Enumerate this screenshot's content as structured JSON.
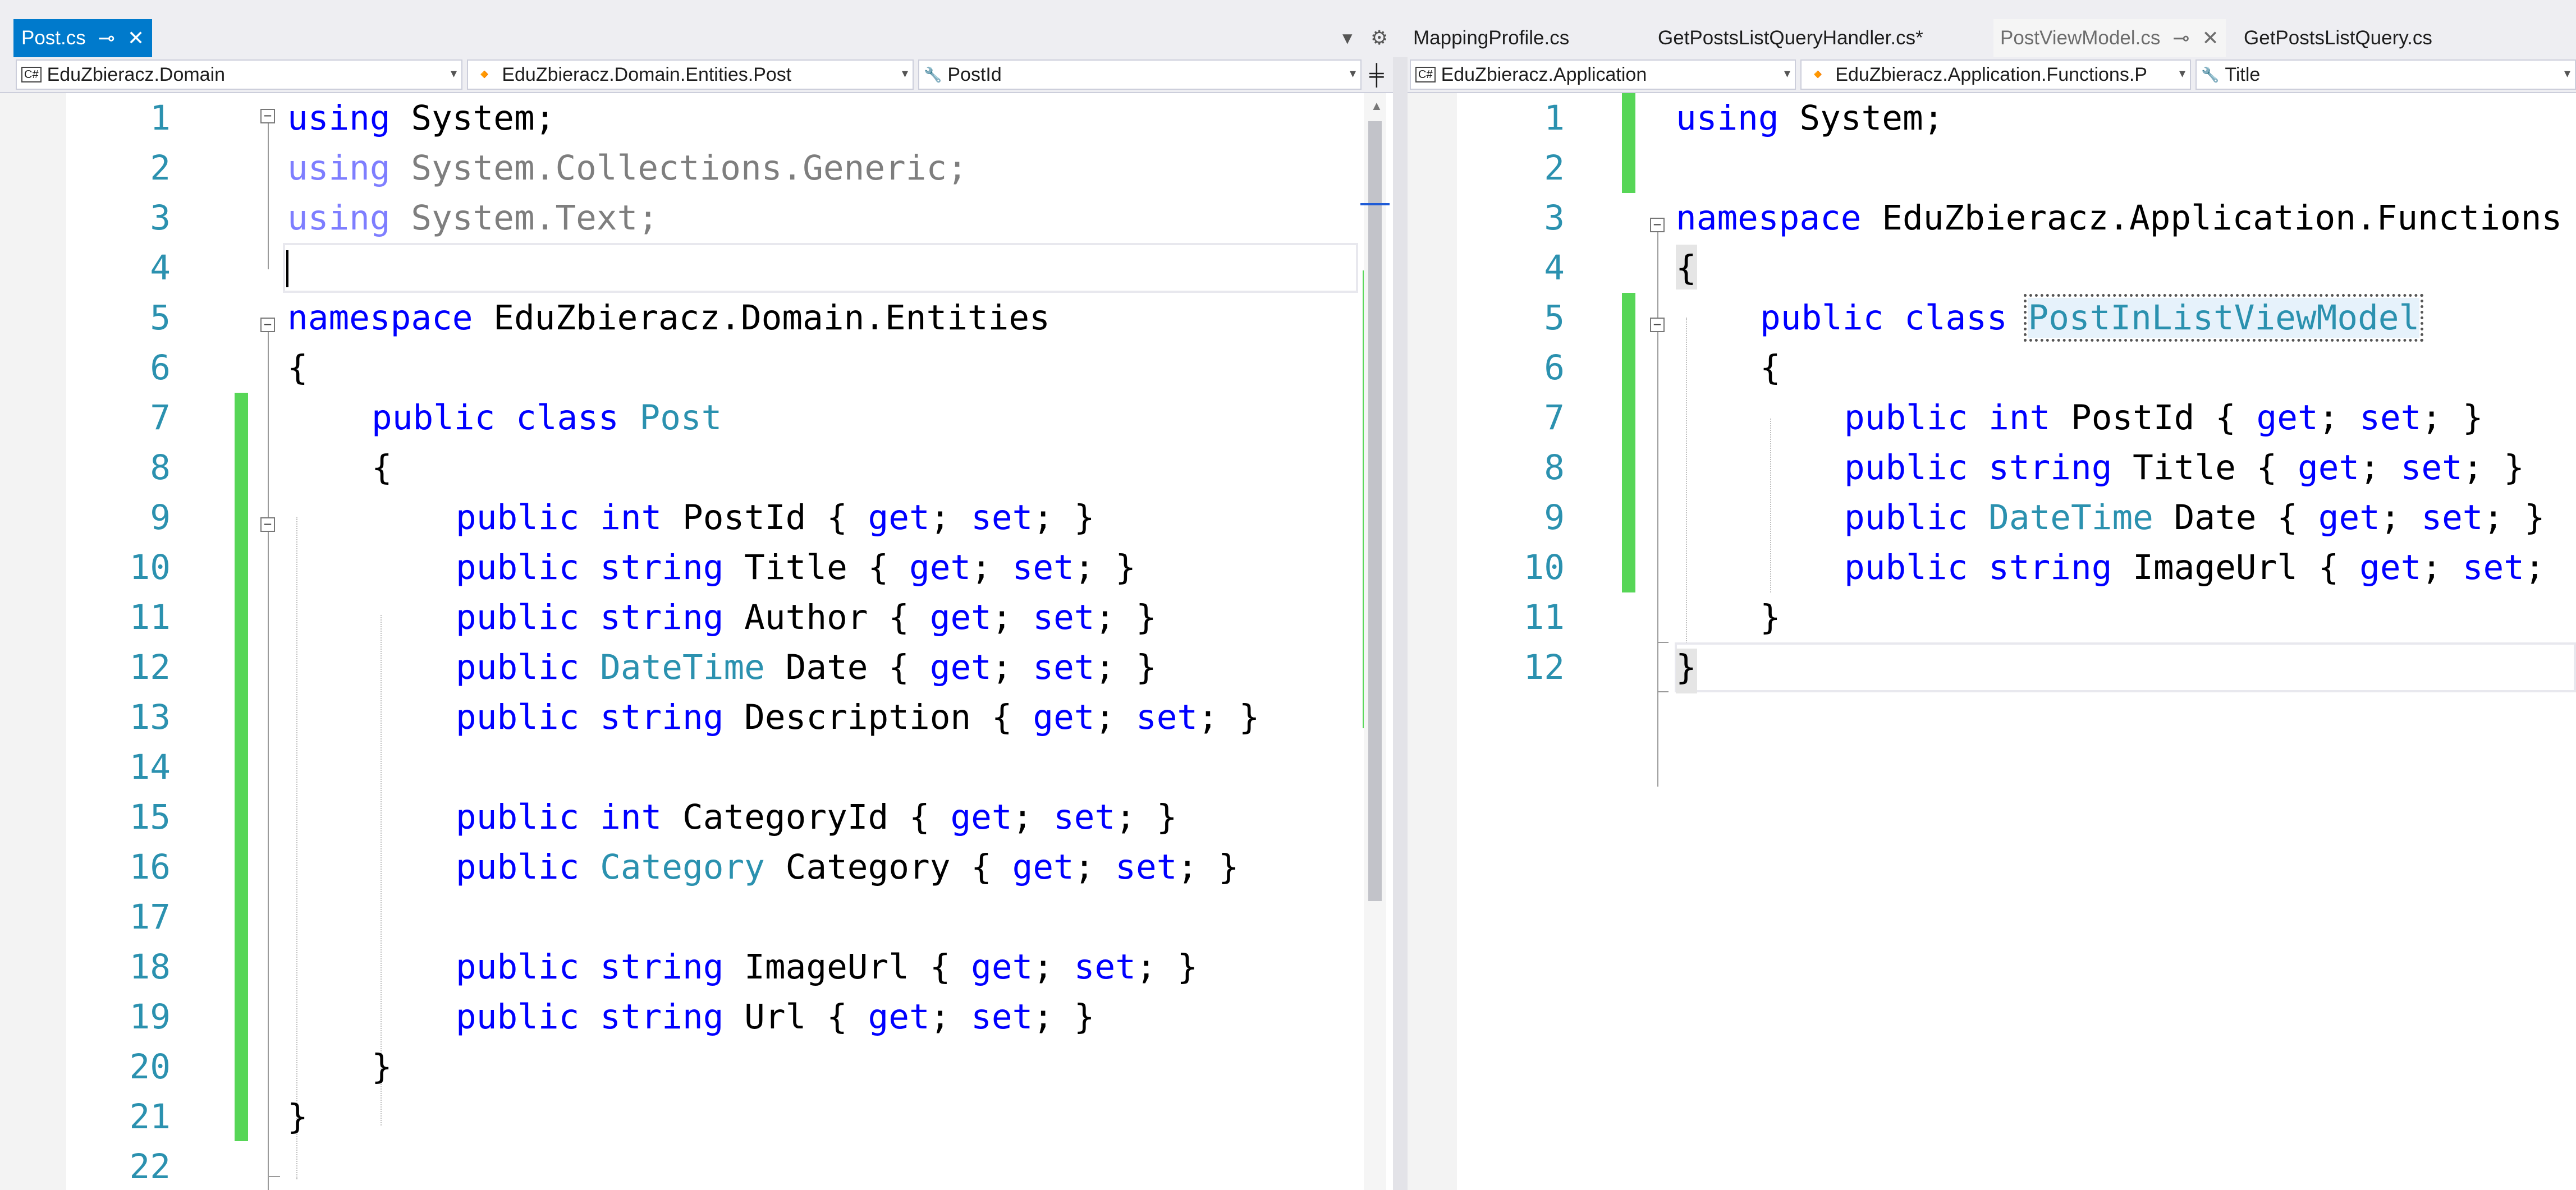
{
  "left_pane": {
    "tabs": [
      {
        "label": "Post.cs",
        "active": true
      }
    ],
    "nav": {
      "project": "EduZbieracz.Domain",
      "type": "EduZbieracz.Domain.Entities.Post",
      "member": "PostId"
    },
    "lines": [
      "1",
      "2",
      "3",
      "4",
      "5",
      "6",
      "7",
      "8",
      "9",
      "10",
      "11",
      "12",
      "13",
      "14",
      "15",
      "16",
      "17",
      "18",
      "19",
      "20",
      "21",
      "22"
    ],
    "code": {
      "l1": [
        "using",
        " System;"
      ],
      "l2": [
        "using",
        " System.Collections.Generic;"
      ],
      "l3": [
        "using",
        " System.Text;"
      ],
      "l5": [
        "namespace",
        " EduZbieracz.Domain.Entities"
      ],
      "l6": "{",
      "l7": [
        "public",
        "class",
        "Post"
      ],
      "l8": "{",
      "l9": [
        "public",
        "int",
        " PostId { ",
        "get",
        "; ",
        "set",
        "; }"
      ],
      "l10": [
        "public",
        "string",
        " Title { ",
        "get",
        "; ",
        "set",
        "; }"
      ],
      "l11": [
        "public",
        "string",
        " Author { ",
        "get",
        "; ",
        "set",
        "; }"
      ],
      "l12": [
        "public",
        "DateTime",
        " Date { ",
        "get",
        "; ",
        "set",
        "; }"
      ],
      "l13": [
        "public",
        "string",
        " Description { ",
        "get",
        "; ",
        "set",
        "; }"
      ],
      "l15": [
        "public",
        "int",
        " CategoryId { ",
        "get",
        "; ",
        "set",
        "; }"
      ],
      "l16": [
        "public",
        "Category",
        " Category { ",
        "get",
        "; ",
        "set",
        "; }"
      ],
      "l18": [
        "public",
        "string",
        " ImageUrl { ",
        "get",
        "; ",
        "set",
        "; }"
      ],
      "l19": [
        "public",
        "string",
        " Url { ",
        "get",
        "; ",
        "set",
        "; }"
      ],
      "l20": "}",
      "l21": "}"
    }
  },
  "right_pane": {
    "tabs": [
      {
        "label": "MappingProfile.cs"
      },
      {
        "label": "GetPostsListQueryHandler.cs*"
      },
      {
        "label": "PostViewModel.cs",
        "preview": true
      },
      {
        "label": "GetPostsListQuery.cs"
      }
    ],
    "nav": {
      "project": "EduZbieracz.Application",
      "type": "EduZbieracz.Application.Functions.P",
      "member": "Title"
    },
    "lines": [
      "1",
      "2",
      "3",
      "4",
      "5",
      "6",
      "7",
      "8",
      "9",
      "10",
      "11",
      "12"
    ],
    "code": {
      "l1": [
        "using",
        " System;"
      ],
      "l3": [
        "namespace",
        " EduZbieracz.Application.Functions"
      ],
      "l4": "{",
      "l5": [
        "public",
        "class",
        "PostInListViewModel"
      ],
      "l6": "{",
      "l7": [
        "public",
        "int",
        " PostId { ",
        "get",
        "; ",
        "set",
        "; }"
      ],
      "l8": [
        "public",
        "string",
        " Title { ",
        "get",
        "; ",
        "set",
        "; }"
      ],
      "l9": [
        "public",
        "DateTime",
        " Date { ",
        "get",
        "; ",
        "set",
        "; }"
      ],
      "l10": [
        "public",
        "string",
        " ImageUrl { ",
        "get",
        "; ",
        "set",
        "; "
      ],
      "l11": "}",
      "l12": "}"
    }
  },
  "icons": {
    "pin": "⊸",
    "close": "✕",
    "dropdown": "▾",
    "gear": "⚙",
    "split": "╪",
    "wrench": "🔧",
    "class": "🔸",
    "fold_open": "−"
  },
  "colors": {
    "active_tab": "#007acc",
    "keyword": "#0000ff",
    "type": "#2b91af",
    "line_number": "#2b91af",
    "change_bar": "#57d657"
  }
}
